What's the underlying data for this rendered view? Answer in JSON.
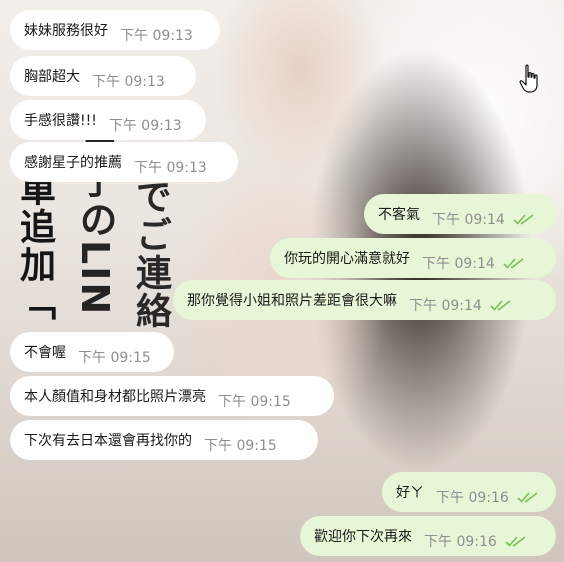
{
  "background": {
    "vertical_text": [
      "單追加「",
      "隼子のLIN",
      "までご連絡"
    ]
  },
  "messages": [
    {
      "side": "in",
      "text": "妹妹服務很好",
      "time": "下午 09:13"
    },
    {
      "side": "in",
      "text": "胸部超大",
      "time": "下午 09:13"
    },
    {
      "side": "in",
      "text": "手感很讚!!!",
      "time": "下午 09:13"
    },
    {
      "side": "in",
      "text": "感謝星子的推薦",
      "time": "下午 09:13"
    },
    {
      "side": "out",
      "text": "不客氣",
      "time": "下午 09:14",
      "read": true
    },
    {
      "side": "out",
      "text": "你玩的開心滿意就好",
      "time": "下午 09:14",
      "read": true
    },
    {
      "side": "out",
      "text": "那你覺得小姐和照片差距會很大嘛",
      "time": "下午 09:14",
      "read": true
    },
    {
      "side": "in",
      "text": "不會喔",
      "time": "下午 09:15"
    },
    {
      "side": "in",
      "text": "本人顏值和身材都比照片漂亮",
      "time": "下午 09:15"
    },
    {
      "side": "in",
      "text": "下次有去日本還會再找你的",
      "time": "下午 09:15"
    },
    {
      "side": "out",
      "text": "好ㄚ",
      "time": "下午 09:16",
      "read": true
    },
    {
      "side": "out",
      "text": "歡迎你下次再來",
      "time": "下午 09:16",
      "read": true
    }
  ],
  "colors": {
    "incoming_bubble": "#ffffff",
    "outgoing_bubble": "#e7f6d7",
    "read_tick": "#7bbf57",
    "time_text": "#8f8f8f"
  },
  "icons": {
    "cursor": "hand-pointer-icon",
    "read_receipt": "double-check-icon"
  }
}
